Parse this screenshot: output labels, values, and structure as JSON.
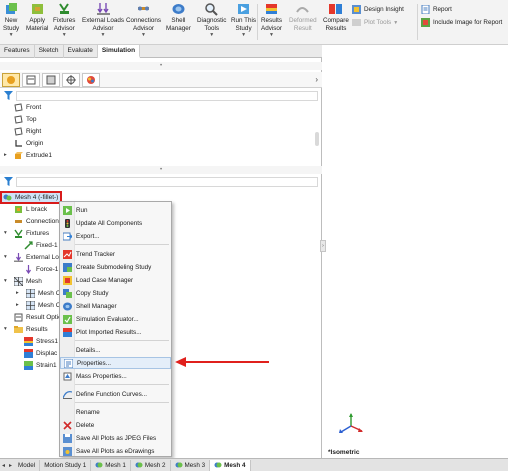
{
  "ribbon": {
    "buttons": [
      {
        "id": "new-study",
        "label": "New",
        "label2": "Study",
        "has_arrow": true,
        "icon": "new-study-icon"
      },
      {
        "id": "apply-material",
        "label": "Apply",
        "label2": "Material",
        "has_arrow": false,
        "icon": "apply-material-icon"
      },
      {
        "id": "fixtures-advisor",
        "label": "Fixtures",
        "label2": "Advisor",
        "has_arrow": true,
        "icon": "fixtures-advisor-icon"
      },
      {
        "id": "external-loads-advisor",
        "label": "External Loads",
        "label2": "Advisor",
        "has_arrow": true,
        "icon": "external-loads-icon"
      },
      {
        "id": "connections-advisor",
        "label": "Connections",
        "label2": "Advisor",
        "has_arrow": true,
        "icon": "connections-icon"
      },
      {
        "id": "shell-manager",
        "label": "Shell",
        "label2": "Manager",
        "has_arrow": false,
        "icon": "shell-manager-icon"
      },
      {
        "id": "diagnostic-tools",
        "label": "Diagnostic",
        "label2": "Tools",
        "has_arrow": true,
        "icon": "diagnostic-icon"
      },
      {
        "id": "run-this-study",
        "label": "Run This",
        "label2": "Study",
        "has_arrow": true,
        "icon": "run-study-icon"
      },
      {
        "id": "results-advisor",
        "label": "Results",
        "label2": "Advisor",
        "has_arrow": true,
        "icon": "results-advisor-icon"
      },
      {
        "id": "deformed-result",
        "label": "Deformed",
        "label2": "Result",
        "has_arrow": false,
        "icon": "deformed-result-icon",
        "disabled": true
      },
      {
        "id": "compare-results",
        "label": "Compare",
        "label2": "Results",
        "has_arrow": false,
        "icon": "compare-results-icon"
      }
    ],
    "small": {
      "design_insight": "Design Insight",
      "plot_tools": "Plot Tools",
      "report": "Report",
      "include_image": "Include Image for Report"
    }
  },
  "tabs": [
    {
      "label": "Features",
      "active": false
    },
    {
      "label": "Sketch",
      "active": false
    },
    {
      "label": "Evaluate",
      "active": false
    },
    {
      "label": "Simulation",
      "active": true
    }
  ],
  "feature_tree": {
    "items": [
      "Front",
      "Top",
      "Right",
      "Origin",
      "Extrude1"
    ]
  },
  "sim_tree": {
    "mesh_label": "Mesh 4 (-fillet-)",
    "items": {
      "lbrack": "L brack",
      "connections": "Connection",
      "fixtures": "Fixtures",
      "fixed": "Fixed-1",
      "external_loads": "External Lo",
      "force": "Force-1",
      "mesh": "Mesh",
      "mesh_c1": "Mesh C",
      "mesh_c2": "Mesh C",
      "result_options": "Result Optio",
      "results": "Results",
      "stress": "Stress1",
      "displacement": "Displac",
      "strain": "Strain1"
    }
  },
  "context_menu": {
    "run": "Run",
    "update_all": "Update All Components",
    "export": "Export...",
    "trend_tracker": "Trend Tracker",
    "create_submodeling": "Create Submodeling Study",
    "load_case_manager": "Load Case Manager",
    "copy_study": "Copy Study",
    "shell_manager": "Shell Manager",
    "simulation_evaluator": "Simulation Evaluator...",
    "plot_imported": "Plot Imported Results...",
    "details": "Details...",
    "properties": "Properties...",
    "mass_properties": "Mass Properties...",
    "define_function_curves": "Define Function Curves...",
    "rename": "Rename",
    "delete": "Delete",
    "save_jpeg": "Save All Plots as JPEG Files",
    "save_edrawings": "Save All Plots as eDrawings"
  },
  "graphics": {
    "view_label": "*Isometric"
  },
  "bottom_tabs": [
    {
      "label": "Model",
      "active": false,
      "icon": false
    },
    {
      "label": "Motion Study 1",
      "active": false,
      "icon": false
    },
    {
      "label": "Mesh 1",
      "active": false,
      "icon": true
    },
    {
      "label": "Mesh 2",
      "active": false,
      "icon": true
    },
    {
      "label": "Mesh 3",
      "active": false,
      "icon": true
    },
    {
      "label": "Mesh 4",
      "active": true,
      "icon": true
    }
  ],
  "colors": {
    "highlight_red": "#d81b1b",
    "selection_blue": "#cfe3f7"
  }
}
